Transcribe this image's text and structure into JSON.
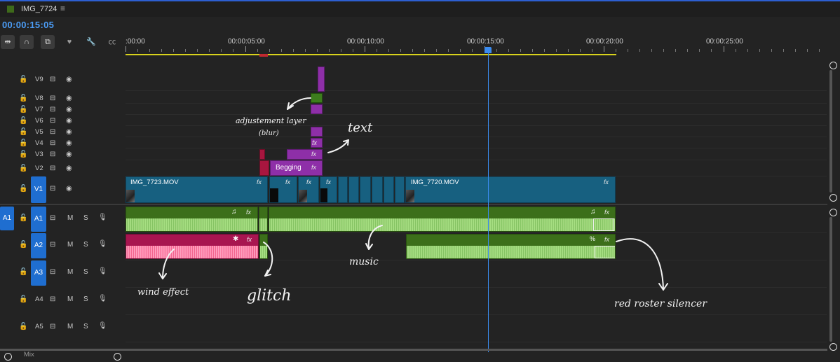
{
  "sequence": {
    "name": "IMG_7724",
    "menu_icon": "hamburger-menu-icon"
  },
  "timecode": "00:00:15:05",
  "ruler": {
    "labels": [
      ":00:00",
      "00:00:05:00",
      "00:00:10:00",
      "00:00:15:00",
      "00:00:20:00",
      "00:00:25:00"
    ]
  },
  "tracks": {
    "video": [
      "V9",
      "V8",
      "V7",
      "V6",
      "V5",
      "V4",
      "V3",
      "V2",
      "V1"
    ],
    "audio": [
      "A1",
      "A2",
      "A3",
      "A4",
      "A5"
    ],
    "source_video": "V1",
    "source_audio": "A1",
    "mute": "M",
    "solo": "S",
    "mix_label": "Mix"
  },
  "clips": {
    "v1_a": "IMG_7723.MOV",
    "v1_b": "IMG_7720.MOV",
    "v2_title": "Begging",
    "fx": "fx"
  },
  "annotations": {
    "adjustment": "adjustement layer",
    "blur": "(blur)",
    "text": "text",
    "music": "music",
    "wind": "wind effect",
    "glitch": "glitch",
    "silencer": "red roster silencer"
  },
  "colors": {
    "video_clip": "#176080",
    "purple_clip": "#8e2fa8",
    "audio_green": "#3c6f1a",
    "audio_pink": "#a81550",
    "playhead": "#3b8cf0",
    "timecode": "#4b9cf5"
  }
}
